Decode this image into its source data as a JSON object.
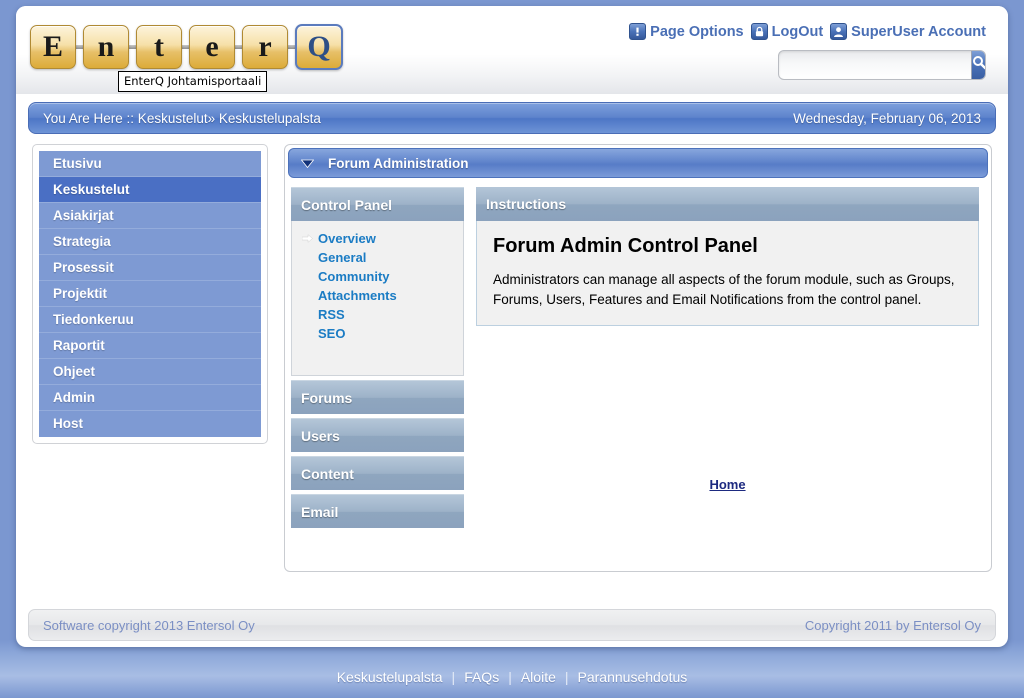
{
  "logo": {
    "letters": [
      "E",
      "n",
      "t",
      "e",
      "r",
      "Q"
    ],
    "tooltip": "EnterQ Johtamisportaali"
  },
  "header": {
    "links": [
      {
        "label": "Page Options",
        "icon": "exclamation-icon"
      },
      {
        "label": "LogOut",
        "icon": "lock-icon"
      },
      {
        "label": "SuperUser Account",
        "icon": "user-icon"
      }
    ],
    "search": {
      "value": "",
      "placeholder": "",
      "button_icon": "search-icon"
    }
  },
  "breadcrumb": {
    "text": "You Are Here :: Keskustelut» Keskustelupalsta",
    "date": "Wednesday, February 06, 2013"
  },
  "sidebar": {
    "items": [
      {
        "label": "Etusivu",
        "active": false
      },
      {
        "label": "Keskustelut",
        "active": true
      },
      {
        "label": "Asiakirjat",
        "active": false
      },
      {
        "label": "Strategia",
        "active": false
      },
      {
        "label": "Prosessit",
        "active": false
      },
      {
        "label": "Projektit",
        "active": false
      },
      {
        "label": "Tiedonkeruu",
        "active": false
      },
      {
        "label": "Raportit",
        "active": false
      },
      {
        "label": "Ohjeet",
        "active": false
      },
      {
        "label": "Admin",
        "active": false
      },
      {
        "label": "Host",
        "active": false
      }
    ]
  },
  "module": {
    "title": "Forum Administration",
    "collapse_icon": "chevron-down-icon",
    "control_panel": {
      "title": "Control Panel",
      "links": [
        {
          "label": "Overview",
          "selected": true
        },
        {
          "label": "General",
          "selected": false
        },
        {
          "label": "Community",
          "selected": false
        },
        {
          "label": "Attachments",
          "selected": false
        },
        {
          "label": "RSS",
          "selected": false
        },
        {
          "label": "SEO",
          "selected": false
        }
      ]
    },
    "accordion": [
      {
        "label": "Forums"
      },
      {
        "label": "Users"
      },
      {
        "label": "Content"
      },
      {
        "label": "Email"
      }
    ],
    "instructions": {
      "header": "Instructions",
      "title": "Forum Admin Control Panel",
      "text": "Administrators can manage all aspects of the forum module, such as Groups, Forums, Users, Features and Email Notifications from the control panel."
    },
    "home_link": "Home"
  },
  "footer": {
    "left": "Software copyright 2013 Entersol Oy",
    "right": "Copyright 2011 by Entersol Oy"
  },
  "bottom_nav": {
    "items": [
      "Keskustelupalsta",
      "FAQs",
      "Aloite",
      "Parannusehdotus"
    ],
    "separator": "|"
  },
  "colors": {
    "page_bg": "#7b97d0",
    "nav_item": "#7e9ad3",
    "nav_active": "#4a6fc4",
    "accent_link": "#1b7cc4",
    "header_link": "#4a6fb5",
    "home_link": "#1d2a80"
  }
}
